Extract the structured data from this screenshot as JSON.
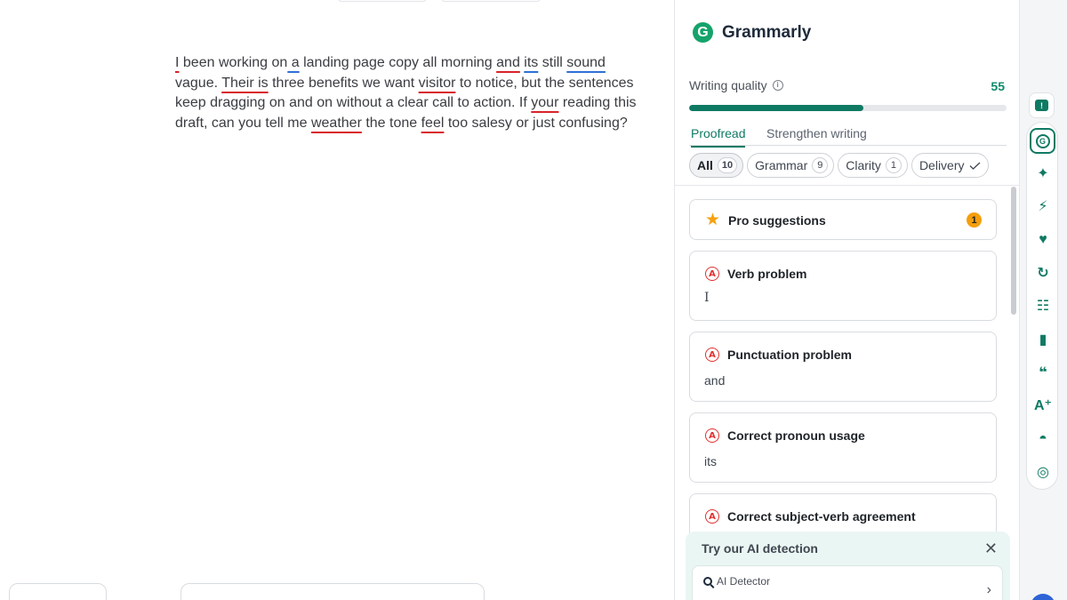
{
  "document": {
    "text": {
      "s1": "I",
      "s2": " been working on",
      "s3": " a",
      "s4": " landing page copy all morning ",
      "s5": "and",
      "s6": " ",
      "s7": "its",
      "s8": " still ",
      "s9": "sound",
      "s10": " vague. ",
      "s11": "Their is",
      "s12": " three benefits we want ",
      "s13": "visitor",
      "s14": " to notice, but the sentences keep dragging on and on without a clear call to action. If ",
      "s15": "your",
      "s16": " reading this draft, can you tell me ",
      "s17": "weather",
      "s18": " the tone ",
      "s19": "feel",
      "s20": " too salesy or just confusing?"
    }
  },
  "panel": {
    "brand": "Grammarly",
    "writing_quality_label": "Writing quality",
    "writing_quality_score": "55",
    "writing_quality_fraction": 0.55,
    "tabs": [
      "Proofread",
      "Strengthen writing"
    ],
    "active_tab": "Proofread",
    "chips": [
      {
        "label": "All",
        "count": "10"
      },
      {
        "label": "Grammar",
        "count": "9"
      },
      {
        "label": "Clarity",
        "count": "1"
      },
      {
        "label": "Delivery",
        "count": ""
      }
    ],
    "cards": [
      {
        "title": "Pro suggestions",
        "badge": "1",
        "icon": "star-icon"
      },
      {
        "title": "Verb problem",
        "excerpt": "I",
        "icon": "alert-a-icon"
      },
      {
        "title": "Punctuation problem",
        "excerpt": "and",
        "icon": "alert-a-icon"
      },
      {
        "title": "Correct pronoun usage",
        "excerpt": "its",
        "icon": "alert-a-icon"
      },
      {
        "title": "Correct subject-verb agreement",
        "excerpt": "",
        "icon": "alert-a-icon"
      }
    ],
    "ai_box": {
      "title": "Try our AI detection",
      "inner_label": "AI Detector"
    }
  },
  "rail": {
    "icons": [
      "feedback-icon",
      "grammarly-icon",
      "assistant-icon",
      "boost-icon",
      "heart-icon",
      "paraphrase-icon",
      "audience-icon",
      "reader-icon",
      "citation-icon",
      "humanize-icon",
      "detective-icon",
      "plagiarism-icon"
    ]
  },
  "colors": {
    "accent": "#0f7a63",
    "error_red": "#d8232a",
    "clarity_blue": "#2f6fd6",
    "pro_badge": "#f59e0b"
  }
}
